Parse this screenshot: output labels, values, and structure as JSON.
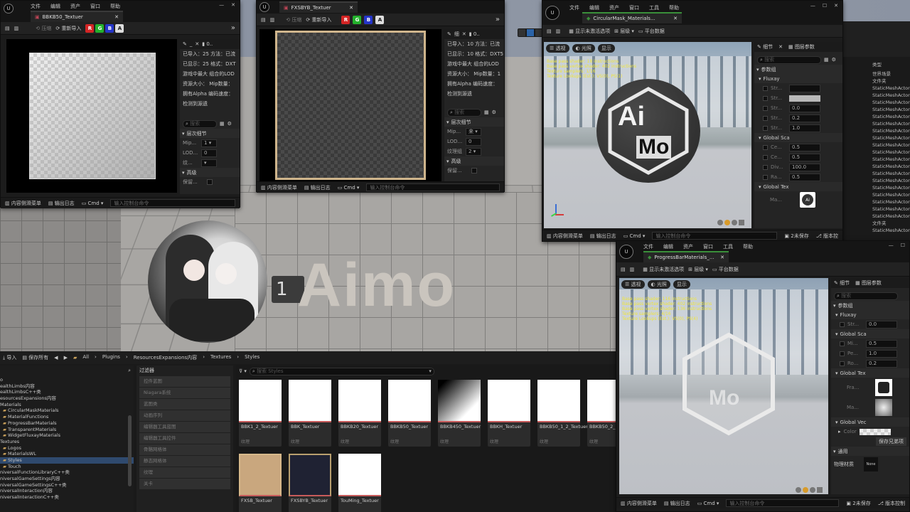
{
  "viewport": {
    "overlay_text": "Aimo",
    "badge_char": "1"
  },
  "win1": {
    "tab_title": "BBKB50_Textuer",
    "menu": [
      "文件",
      "编辑",
      "资产",
      "窗口",
      "帮助"
    ],
    "toolbar": {
      "compress": "压缩",
      "reimport": "重新导入"
    },
    "channels": [
      "R",
      "G",
      "B",
      "A"
    ],
    "info_lines": [
      "已导入：25  方法：已流",
      "已显示：25  格式：DXT",
      "游戏中最大  组合的LOD",
      "资源大小：  Mip数量：",
      "拥有Alpha  编码速度：",
      "检测到源遗"
    ],
    "search_placeholder": "搜索",
    "section_lod": "层次细节",
    "lod_rows": [
      {
        "label": "Mip...",
        "value": "1"
      },
      {
        "label": "LOD...",
        "value": "0"
      },
      {
        "label": "纹...",
        "value": ""
      }
    ],
    "section_advanced": "高级",
    "advanced_row": "保留...",
    "bottom": {
      "drawer": "内容侧滑菜单",
      "log": "输出日志",
      "cmd": "Cmd",
      "cmd_placeholder": "输入控制台命令"
    }
  },
  "win2": {
    "tab_title": "FXSBYB_Textuer",
    "toolbar": {
      "compress": "压缩",
      "reimport": "重新导入"
    },
    "channels": [
      "R",
      "G",
      "B",
      "A"
    ],
    "info_lines": [
      "已导入：10  方法：已流",
      "已显示：10  格式：DXT5",
      "游戏中最大  组合的LOD",
      "资源大小：  Mip数量：1",
      "拥有Alpha  编码速度：",
      "检测到源遗"
    ],
    "search_placeholder": "搜索",
    "section_lod": "层次细节",
    "lod_rows": [
      {
        "label": "Mip...",
        "value": "来"
      },
      {
        "label": "LOD...",
        "value": "0"
      },
      {
        "label": "纹理组",
        "value": "2"
      }
    ],
    "section_advanced": "高级",
    "advanced_row": "保留...",
    "bottom": {
      "drawer": "内容侧滑菜单",
      "log": "输出日志",
      "cmd": "Cmd",
      "cmd_placeholder": "输入控制台命令"
    }
  },
  "win3": {
    "tab_title": "CircularMask_Materials...",
    "menu": [
      "文件",
      "编辑",
      "资产",
      "窗口",
      "工具",
      "帮助"
    ],
    "toolbar": {
      "show_inactive": "显示未激活选项",
      "hierarchy": "层级",
      "platform": "平台数据"
    },
    "vp_buttons": [
      "透视",
      "光照",
      "显示"
    ],
    "vp_stats": [
      "Base pass shader: 18 instructions",
      "Base pass vertex shader: 402 instructions",
      "Texture samplers: 1/16",
      "Texture Lookups (Est.): VS(0), PS(1)"
    ],
    "logo_top": "Ai",
    "logo_bottom": "Mo",
    "details": {
      "tab_details": "细节",
      "tab_params": "图层参数",
      "search_placeholder": "搜索",
      "params_header": "参数组",
      "group1": "Fluxay",
      "group1_rows": [
        {
          "label": "Str...",
          "value": ""
        },
        {
          "label": "Str...",
          "value": ""
        },
        {
          "label": "Str...",
          "value": "0.0"
        },
        {
          "label": "Str...",
          "value": "0.2"
        },
        {
          "label": "Str...",
          "value": "1.0"
        }
      ],
      "group2": "Global Sca",
      "group2_rows": [
        {
          "label": "Ce...",
          "value": "0.5"
        },
        {
          "label": "Ce...",
          "value": "0.5"
        },
        {
          "label": "Div...",
          "value": "100.0"
        },
        {
          "label": "Ra...",
          "value": "0.5"
        }
      ],
      "group3": "Global Tex",
      "group3_row": "Ma..."
    },
    "bottom": {
      "drawer": "内容侧滑菜单",
      "log": "输出日志",
      "cmd": "Cmd",
      "cmd_placeholder": "输入控制台命令",
      "unsaved": "2未保存",
      "version": "版本控"
    }
  },
  "outliner": {
    "header": "类型",
    "rows": [
      "世界场景",
      "文件夹",
      "StaticMeshActor",
      "StaticMeshActor",
      "StaticMeshActor",
      "StaticMeshActor",
      "StaticMeshActor",
      "StaticMeshActor",
      "StaticMeshActor",
      "StaticMeshActor",
      "StaticMeshActor",
      "StaticMeshActor",
      "StaticMeshActor",
      "StaticMeshActor",
      "StaticMeshActor",
      "StaticMeshActor",
      "StaticMeshActor",
      "StaticMeshActor",
      "StaticMeshActor",
      "StaticMeshActor",
      "StaticMeshActor",
      "文件夹",
      "StaticMeshActor"
    ]
  },
  "win4": {
    "tab_title": "ProgressBarMaterials_...",
    "menu": [
      "文件",
      "编辑",
      "资产",
      "窗口",
      "工具",
      "帮助"
    ],
    "toolbar": {
      "show_inactive": "显示未激活选项",
      "hierarchy": "层级",
      "platform": "平台数据"
    },
    "vp_buttons": [
      "透视",
      "光照",
      "显示"
    ],
    "vp_stats": [
      "Base pass shader: 116 instructions",
      "Base pass vertex shader: 402 instructions",
      "Base pass vertex shader: 136 instructions",
      "Texture samplers: 4/16",
      "Texture Lookups (Est.): VS(0), PS(4)"
    ],
    "logo_bottom": "Mo",
    "details": {
      "tab_details": "细节",
      "tab_params": "图层参数",
      "search_placeholder": "搜索",
      "params_header": "参数组",
      "group1": "Fluxay",
      "group1_rows": [
        {
          "label": "Str...",
          "value": "0.0"
        }
      ],
      "group2": "Global Sca",
      "group2_rows": [
        {
          "label": "Mi...",
          "value": "0.5"
        },
        {
          "label": "Pe...",
          "value": "1.0"
        },
        {
          "label": "Ro...",
          "value": "0.2"
        }
      ],
      "group3": "Global Tex",
      "group3_rows": [
        "Fra...",
        "Ma..."
      ],
      "group4": "Global Vec",
      "group4_row": "Color",
      "save_sibling": "保存兄弟项",
      "general": "通用",
      "phys_label": "物理材质",
      "phys_value": "None"
    },
    "bottom": {
      "drawer": "内容侧滑菜单",
      "log": "输出日志",
      "cmd": "Cmd",
      "cmd_placeholder": "输入控制台命令",
      "unsaved": "2未保存",
      "version": "版本控制"
    }
  },
  "content_browser": {
    "toolbar": {
      "import": "导入",
      "save_all": "保存所有"
    },
    "breadcrumb": [
      "All",
      "Plugins",
      "ResourcesExpansions内容",
      "Textures",
      "Styles"
    ],
    "tree": [
      "o",
      "ealthLimbs内容",
      "ealthLimbsC++类",
      "esourcesExpansions内容",
      "Materials",
      "CircularMaskMaterials",
      "MaterialFunctions",
      "ProgressBarMaterials",
      "TransparentMaterials",
      "WidgetFluxayMaterials",
      "Textures",
      "Logos",
      "MaterialsWL",
      "Styles",
      "Touch",
      "niversalFunctionLibraryC++类",
      "niversalGameSettings内容",
      "niversalGameSettingsC++类",
      "niversalInteraction内容",
      "niversalInteractionC++类"
    ],
    "filters_header": "过滤器",
    "filters": [
      "控件蓝图",
      "Niagara系统",
      "蓝图类",
      "动画序列",
      "编辑器工具蓝图",
      "编辑器工具控件",
      "骨骼网格体",
      "静态网格体",
      "纹理",
      "关卡"
    ],
    "search_placeholder": "搜索 Styles",
    "assets": [
      {
        "name": "BBK1_2_Textuer",
        "type": "纹理"
      },
      {
        "name": "BBK_Textuer",
        "type": "纹理"
      },
      {
        "name": "BBKB20_Textuer",
        "type": "纹理"
      },
      {
        "name": "BBKB50_Textuer",
        "type": "纹理"
      },
      {
        "name": "BBKB450_Textuer",
        "type": "纹理"
      },
      {
        "name": "BBKH_Textuer",
        "type": "纹理"
      },
      {
        "name": "BBKB50_1_2_Textuer",
        "type": "纹理"
      },
      {
        "name": "BBKB50_2_1_Textuer",
        "type": "纹理"
      },
      {
        "name": "FXSB_Textuer",
        "type": "纹理"
      },
      {
        "name": "FXSBYB_Textuer",
        "type": "纹理"
      },
      {
        "name": "TouMing_Textuer",
        "type": "纹理"
      }
    ]
  },
  "colors": {
    "red": "#d42525",
    "green": "#23b12c",
    "blue": "#2535c9",
    "accent_tab": "#3a8f3a",
    "asset_underline": "#c75b5b",
    "stat_yellow": "#f0e53b"
  }
}
